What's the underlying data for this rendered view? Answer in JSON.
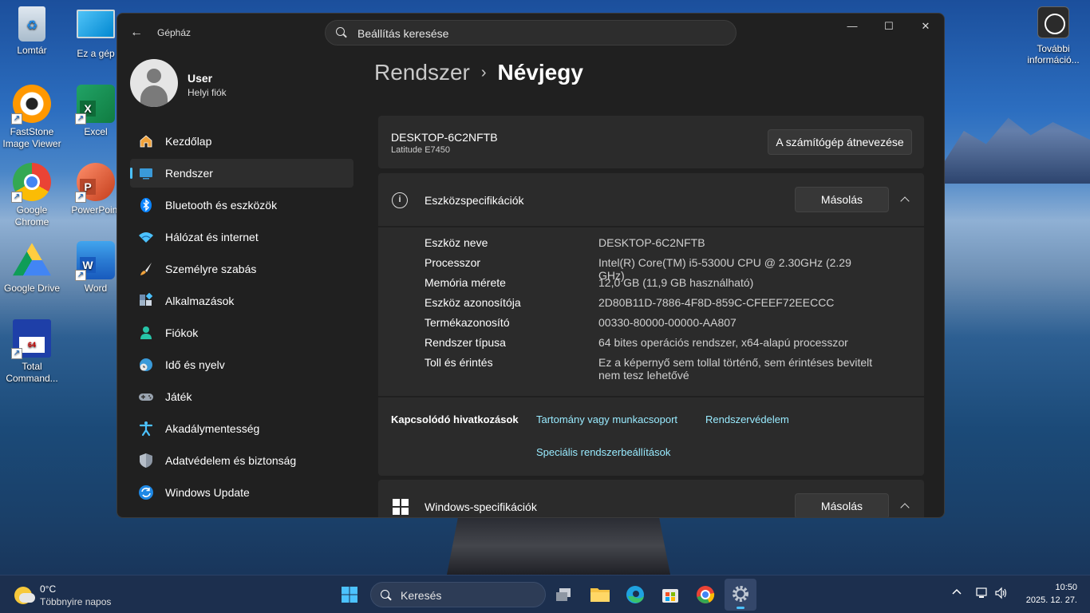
{
  "desktop": {
    "icons": [
      {
        "label": "Lomtár"
      },
      {
        "label": "Ez a gép"
      },
      {
        "label": "FastStone Image Viewer"
      },
      {
        "label": "Excel"
      },
      {
        "label": "Google Chrome"
      },
      {
        "label": "PowerPoint"
      },
      {
        "label": "Google Drive"
      },
      {
        "label": "Word"
      },
      {
        "label": "Total Command..."
      }
    ],
    "top_right_icon": {
      "label": "További információ..."
    }
  },
  "window": {
    "app_title": "Gépház",
    "search_placeholder": "Beállítás keresése",
    "controls": {
      "minimize": "—",
      "maximize": "☐",
      "close": "✕"
    }
  },
  "profile": {
    "name": "User",
    "account_type": "Helyi fiók"
  },
  "nav": [
    {
      "label": "Kezdőlap",
      "icon": "home-icon"
    },
    {
      "label": "Rendszer",
      "icon": "system-icon",
      "active": true
    },
    {
      "label": "Bluetooth és eszközök",
      "icon": "bluetooth-icon"
    },
    {
      "label": "Hálózat és internet",
      "icon": "wifi-icon"
    },
    {
      "label": "Személyre szabás",
      "icon": "brush-icon"
    },
    {
      "label": "Alkalmazások",
      "icon": "apps-icon"
    },
    {
      "label": "Fiókok",
      "icon": "accounts-icon"
    },
    {
      "label": "Idő és nyelv",
      "icon": "time-language-icon"
    },
    {
      "label": "Játék",
      "icon": "gamepad-icon"
    },
    {
      "label": "Akadálymentesség",
      "icon": "accessibility-icon"
    },
    {
      "label": "Adatvédelem és biztonság",
      "icon": "shield-icon"
    },
    {
      "label": "Windows Update",
      "icon": "update-icon"
    }
  ],
  "breadcrumb": {
    "parent": "Rendszer",
    "separator": "›",
    "current": "Névjegy"
  },
  "device_card": {
    "pc_name": "DESKTOP-6C2NFTB",
    "model": "Latitude E7450",
    "rename_button": "A számítógép átnevezése"
  },
  "device_specs": {
    "title": "Eszközspecifikációk",
    "copy_button": "Másolás",
    "rows": [
      {
        "key": "Eszköz neve",
        "value": "DESKTOP-6C2NFTB"
      },
      {
        "key": "Processzor",
        "value": "Intel(R) Core(TM) i5-5300U CPU @ 2.30GHz (2.29 GHz)"
      },
      {
        "key": "Memória mérete",
        "value": "12,0 GB (11,9 GB használható)"
      },
      {
        "key": "Eszköz azonosítója",
        "value": "2D80B11D-7886-4F8D-859C-CFEEF72EECCC"
      },
      {
        "key": "Termékazonosító",
        "value": "00330-80000-00000-AA807"
      },
      {
        "key": "Rendszer típusa",
        "value": "64 bites operációs rendszer, x64-alapú processzor"
      },
      {
        "key": "Toll és érintés",
        "value": "Ez a képernyő sem tollal történő, sem érintéses bevitelt nem tesz lehetővé"
      }
    ]
  },
  "related_links": {
    "title": "Kapcsolódó hivatkozások",
    "links": [
      "Tartomány vagy munkacsoport",
      "Rendszervédelem",
      "Speciális rendszerbeállítások"
    ]
  },
  "windows_specs": {
    "title": "Windows-specifikációk",
    "copy_button": "Másolás"
  },
  "taskbar": {
    "weather": {
      "temp": "0°C",
      "desc": "Többnyire napos"
    },
    "search_placeholder": "Keresés",
    "clock": {
      "time": "10:50",
      "date": "2025. 12. 27."
    }
  }
}
